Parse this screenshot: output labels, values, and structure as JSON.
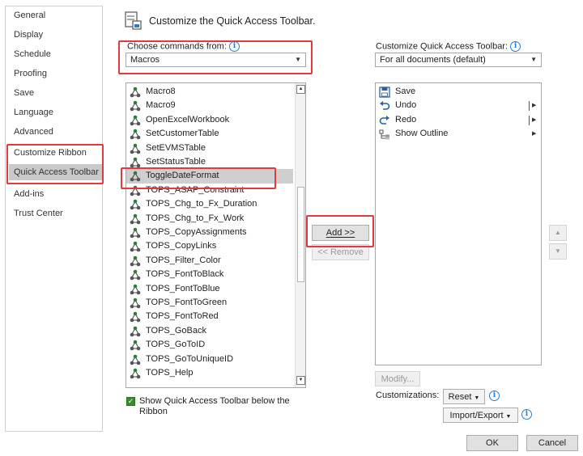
{
  "nav": {
    "items": [
      "General",
      "Display",
      "Schedule",
      "Proofing",
      "Save",
      "Language",
      "Advanced",
      "Customize Ribbon",
      "Quick Access Toolbar",
      "Add-ins",
      "Trust Center"
    ],
    "selected": "Quick Access Toolbar"
  },
  "header": {
    "title": "Customize the Quick Access Toolbar."
  },
  "commands": {
    "label": "Choose commands from:",
    "info": "i",
    "selected": "Macros",
    "items": [
      "Macro8",
      "Macro9",
      "OpenExcelWorkbook",
      "SetCustomerTable",
      "SetEVMSTable",
      "SetStatusTable",
      "ToggleDateFormat",
      "TOPS_ASAP_Constraint",
      "TOPS_Chg_to_Fx_Duration",
      "TOPS_Chg_to_Fx_Work",
      "TOPS_CopyAssignments",
      "TOPS_CopyLinks",
      "TOPS_Filter_Color",
      "TOPS_FontToBlack",
      "TOPS_FontToBlue",
      "TOPS_FontToGreen",
      "TOPS_FontToRed",
      "TOPS_GoBack",
      "TOPS_GoToID",
      "TOPS_GoToUniqueID",
      "TOPS_Help"
    ],
    "selected_item": "ToggleDateFormat"
  },
  "actions": {
    "add": "Add >>",
    "remove": "<< Remove"
  },
  "qat": {
    "label": "Customize Quick Access Toolbar:",
    "info": "i",
    "selected": "For all documents (default)",
    "items": [
      {
        "label": "Save",
        "icon": "save-icon"
      },
      {
        "label": "Undo",
        "icon": "undo-icon"
      },
      {
        "label": "Redo",
        "icon": "redo-icon"
      },
      {
        "label": "Show Outline",
        "icon": "outline-icon"
      }
    ]
  },
  "move": {
    "up": "▲",
    "down": "▼"
  },
  "bottom": {
    "show_below": "Show Quick Access Toolbar below the Ribbon",
    "show_below_line1": "Show Quick Access Toolbar below the",
    "show_below_line2": "Ribbon",
    "modify": "Modify...",
    "customizations": "Customizations:",
    "reset": "Reset",
    "import_export": "Import/Export",
    "info": "i",
    "ok": "OK",
    "cancel": "Cancel"
  },
  "colors": {
    "highlight": "#e03a3e",
    "selection": "#cfcfcf",
    "accent": "#2d7bd1"
  }
}
